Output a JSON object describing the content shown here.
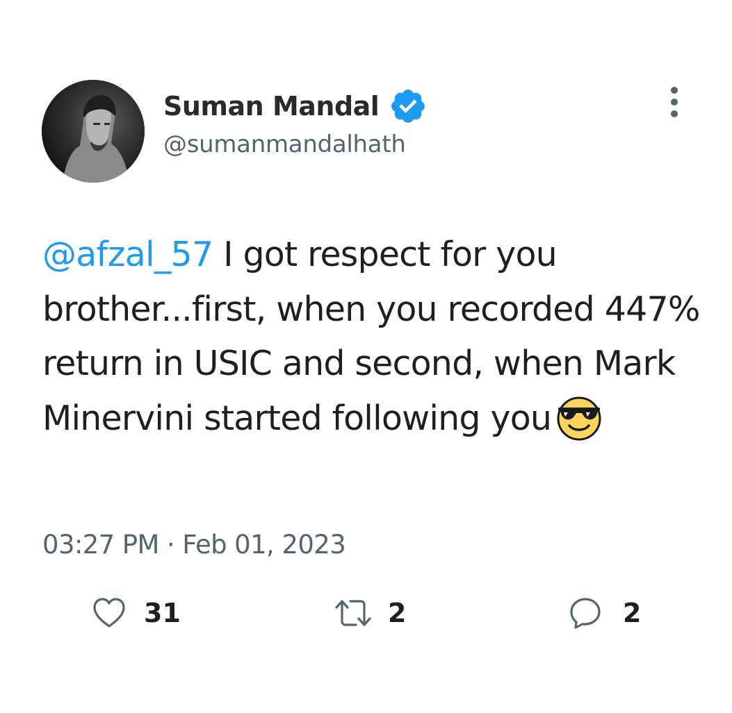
{
  "author": {
    "display_name": "Suman Mandal",
    "handle": "@sumanmandalhath",
    "verified": true,
    "verified_color": "#1d9bf0"
  },
  "tweet": {
    "mention": "@afzal_57",
    "text": " I got respect for you brother...first, when you recorded 447% return in USIC and second, when Mark Minervini started following you",
    "emoji": "smiling-face-with-sunglasses",
    "timestamp": "03:27 PM · Feb 01, 2023"
  },
  "actions": {
    "likes": "31",
    "retweets": "2",
    "replies": "2"
  },
  "colors": {
    "link": "#1d9bf0",
    "secondary_text": "#536471",
    "primary_text": "#1f1f1f"
  },
  "icons": {
    "more": "vertical-ellipsis-icon",
    "like": "heart-icon",
    "retweet": "retweet-icon",
    "reply": "speech-bubble-icon"
  }
}
